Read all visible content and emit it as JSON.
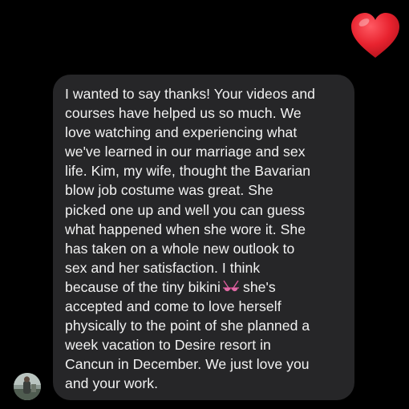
{
  "reaction": {
    "emoji": "heart-icon",
    "color": "#e8232f"
  },
  "message": {
    "bubble_color": "#262628",
    "text_color": "#f2f2f2",
    "lines": [
      "I wanted to say thanks! Your videos and",
      "courses have helped us so much.   We",
      "love watching and experiencing what",
      "we've learned in our marriage and sex",
      "life.  Kim, my wife, thought the Bavarian",
      "blow job costume was great. She",
      "picked one up and well you can guess",
      "what happened when she wore it.   She",
      "has taken on a whole new outlook to",
      "sex and her satisfaction.  I think",
      "because of the tiny bikini",
      "she's",
      "accepted and come to love herself",
      "physically to the point of she planned a",
      "week vacation to Desire resort in",
      "Cancun in December.   We just love you",
      "and your work."
    ],
    "inline_emoji": "bikini-icon"
  },
  "sender": {
    "avatar": "avatar-photo"
  }
}
